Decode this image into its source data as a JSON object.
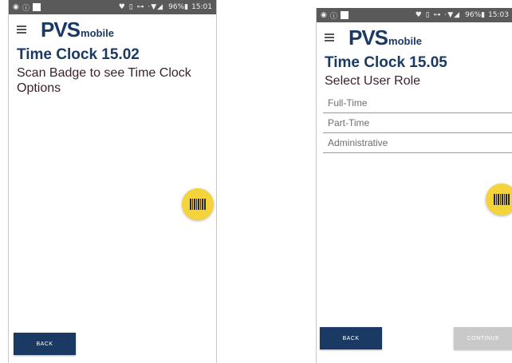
{
  "left_screen": {
    "status": {
      "icons": "♥ ▯ ⊶ ·▼◢",
      "battery": "96%",
      "time": "15:01"
    },
    "logo": {
      "main": "PVS",
      "suffix": "mobile"
    },
    "title": "Time Clock 15.02",
    "subtitle": "Scan Badge to see Time Clock Options",
    "back_label": "BACK"
  },
  "right_screen": {
    "status": {
      "icons": "♥ ▯ ⊶ ·▼◢",
      "battery": "96%",
      "time": "15:03"
    },
    "logo": {
      "main": "PVS",
      "suffix": "mobile"
    },
    "title": "Time Clock 15.05",
    "subtitle": "Select User Role",
    "roles": [
      "Full-Time",
      "Part-Time",
      "Administrative"
    ],
    "back_label": "BACK",
    "continue_label": "CONTINUE"
  },
  "colors": {
    "brand": "#1a3a64",
    "fab": "#f5d33a",
    "status_bar": "#5a5a5a",
    "disabled": "#c9c9c9"
  },
  "icons": {
    "menu": "hamburger-icon",
    "fab": "barcode-icon"
  }
}
